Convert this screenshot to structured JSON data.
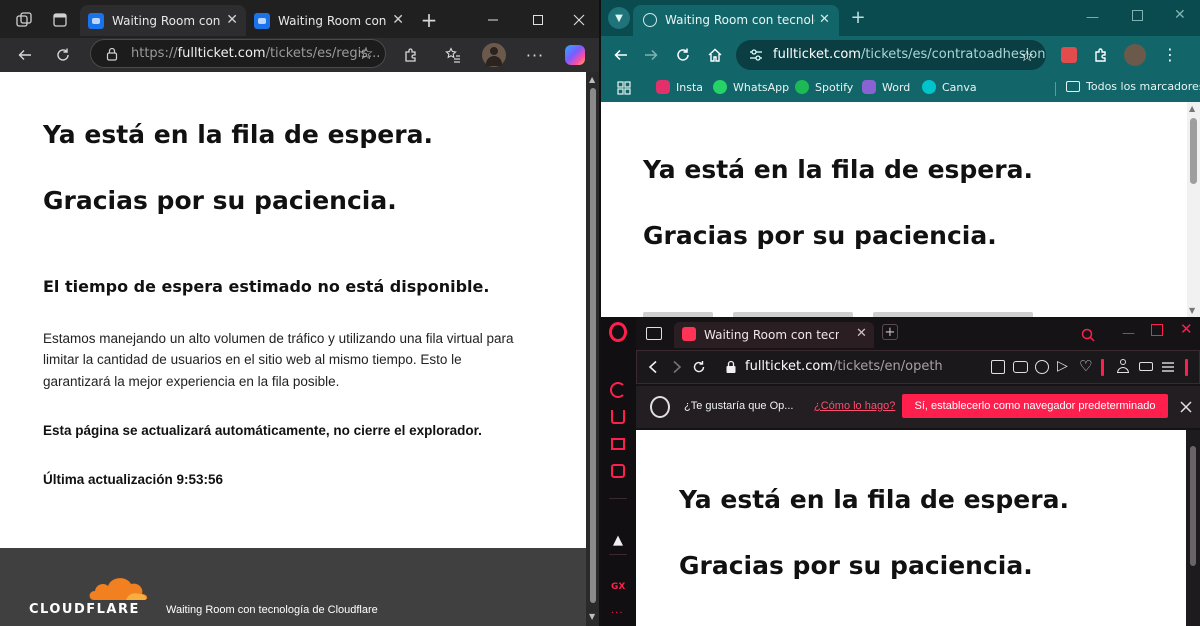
{
  "edge": {
    "tabs": [
      {
        "title": "Waiting Room con tecnología de Cloudflare"
      },
      {
        "title": "Waiting Room con tecnología de Cloudflare"
      }
    ],
    "url_prefix": "https://",
    "url_domain": "fullticket.com",
    "url_path": "/tickets/es/regis...",
    "page": {
      "heading1": "Ya está en la fila de espera.",
      "heading2": "Gracias por su paciencia.",
      "subheading": "El tiempo de espera estimado no está disponible.",
      "paragraph_line1": "Estamos manejando un alto volumen de tráfico y utilizando una fila virtual para",
      "paragraph_line2": "limitar la cantidad de usuarios en el sitio web al mismo tiempo. Esto le",
      "paragraph_line3": "garantizará la mejor experiencia en la fila posible.",
      "notice": "Esta página se actualizará automáticamente, no cierre el explorador.",
      "last_update": "Última actualización 9:53:56"
    },
    "footer": {
      "logo_text": "CLOUDFLARE",
      "caption": "Waiting Room con tecnología de Cloudflare"
    },
    "icons": {
      "workspaces": "workspaces-icon",
      "tab_actions": "tab-actions-icon",
      "new_tab": "plus-icon",
      "back": "back-arrow-icon",
      "refresh": "refresh-icon",
      "lock": "lock-icon",
      "favorite": "star-icon",
      "extensions": "puzzle-icon",
      "favorites_hub": "favorites-icon",
      "profile": "avatar-icon",
      "more": "more-icon",
      "copilot": "copilot-icon"
    }
  },
  "chrome": {
    "tab_title": "Waiting Room con tecnología de Cloudflare",
    "url_domain": "fullticket.com",
    "url_path": "/tickets/es/contratoadhesion",
    "bookmarks": [
      {
        "label": "Insta",
        "color": "#e1306c"
      },
      {
        "label": "WhatsApp",
        "color": "#25d366"
      },
      {
        "label": "Spotify",
        "color": "#1db954"
      },
      {
        "label": "Word",
        "color": "#8a63d2"
      },
      {
        "label": "Canva",
        "color": "#00c4cc"
      }
    ],
    "all_bookmarks": "Todos los marcadores",
    "page": {
      "heading1": "Ya está en la fila de espera.",
      "heading2": "Gracias por su paciencia."
    }
  },
  "opera": {
    "tab_title": "Waiting Room con tecnología de Cloudflare",
    "url_domain": "fullticket.com",
    "url_path": "/tickets/en/opeth",
    "infobar": {
      "question": "¿Te gustaría que Op...",
      "link": "¿Cómo lo hago?",
      "button": "Sí, establecerlo como navegador predeterminado"
    },
    "sidebar_gx": "GX",
    "page": {
      "heading1": "Ya está en la fila de espera.",
      "heading2": "Gracias por su paciencia."
    },
    "accent": "#ff1f4d"
  }
}
